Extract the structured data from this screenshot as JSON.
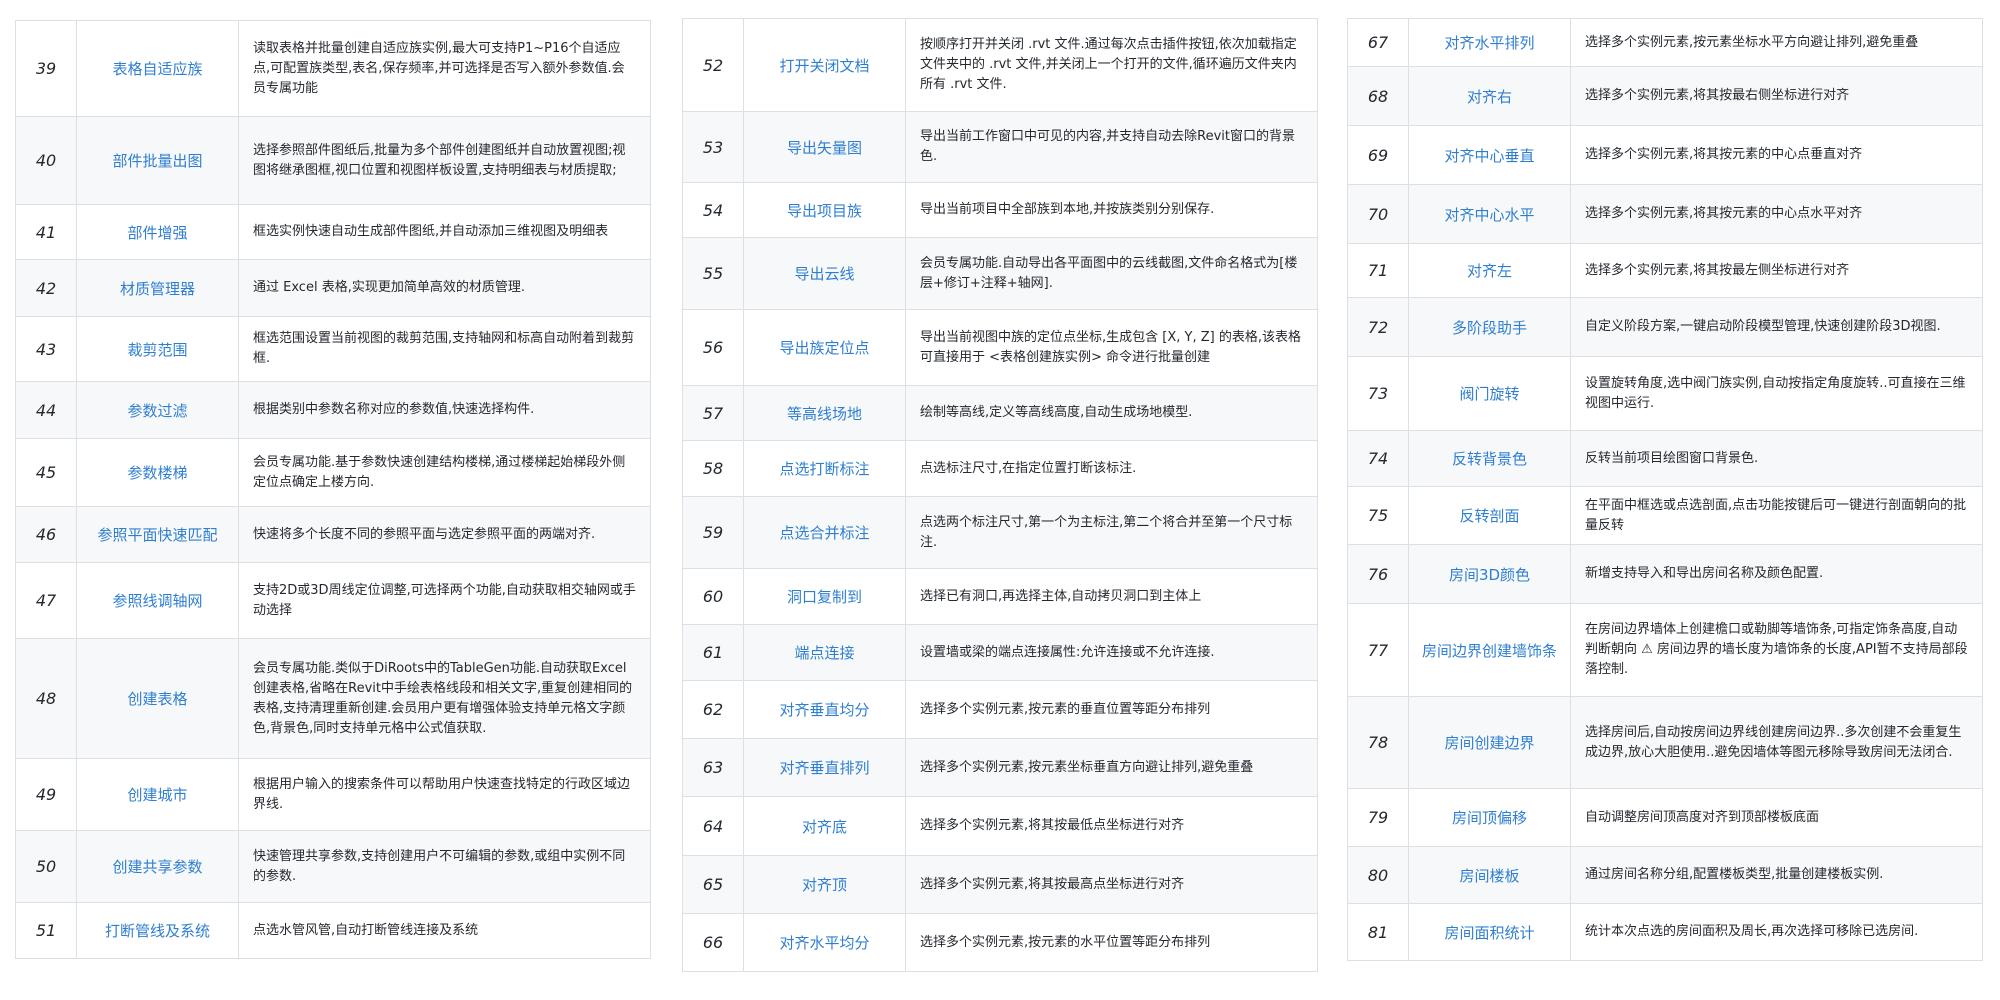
{
  "columns": [
    {
      "rows": [
        {
          "num": "39",
          "name": "表格自适应族",
          "desc": "读取表格并批量创建自适应族实例,最大可支持P1~P16个自适应点,可配置族类型,表名,保存频率,并可选择是否写入额外参数值.会员专属功能"
        },
        {
          "num": "40",
          "name": "部件批量出图",
          "desc": "选择参照部件图纸后,批量为多个部件创建图纸并自动放置视图;视图将继承图框,视口位置和视图样板设置,支持明细表与材质提取;"
        },
        {
          "num": "41",
          "name": "部件增强",
          "desc": "框选实例快速自动生成部件图纸,并自动添加三维视图及明细表"
        },
        {
          "num": "42",
          "name": "材质管理器",
          "desc": "通过 Excel 表格,实现更加简单高效的材质管理."
        },
        {
          "num": "43",
          "name": "裁剪范围",
          "desc": "框选范围设置当前视图的裁剪范围,支持轴网和标高自动附着到裁剪框."
        },
        {
          "num": "44",
          "name": "参数过滤",
          "desc": "根据类别中参数名称对应的参数值,快速选择构件."
        },
        {
          "num": "45",
          "name": "参数楼梯",
          "desc": "会员专属功能.基于参数快速创建结构楼梯,通过楼梯起始梯段外侧定位点确定上楼方向."
        },
        {
          "num": "46",
          "name": "参照平面快速匹配",
          "desc": "快速将多个长度不同的参照平面与选定参照平面的两端对齐."
        },
        {
          "num": "47",
          "name": "参照线调轴网",
          "desc": "支持2D或3D周线定位调整,可选择两个功能,自动获取相交轴网或手动选择"
        },
        {
          "num": "48",
          "name": "创建表格",
          "desc": "会员专属功能.类似于DiRoots中的TableGen功能.自动获取Excel创建表格,省略在Revit中手绘表格线段和相关文字,重复创建相同的表格,支持清理重新创建.会员用户更有增强体验支持单元格文字颜色,背景色,同时支持单元格中公式值获取."
        },
        {
          "num": "49",
          "name": "创建城市",
          "desc": "根据用户输入的搜索条件可以帮助用户快速查找特定的行政区域边界线."
        },
        {
          "num": "50",
          "name": "创建共享参数",
          "desc": "快速管理共享参数,支持创建用户不可编辑的参数,或组中实例不同的参数."
        },
        {
          "num": "51",
          "name": "打断管线及系统",
          "desc": "点选水管风管,自动打断管线连接及系统"
        }
      ]
    },
    {
      "rows": [
        {
          "num": "52",
          "name": "打开关闭文档",
          "desc": "按顺序打开并关闭 .rvt 文件.通过每次点击插件按钮,依次加载指定文件夹中的 .rvt 文件,并关闭上一个打开的文件,循环遍历文件夹内所有 .rvt 文件."
        },
        {
          "num": "53",
          "name": "导出矢量图",
          "desc": "导出当前工作窗口中可见的内容,并支持自动去除Revit窗口的背景色."
        },
        {
          "num": "54",
          "name": "导出项目族",
          "desc": "导出当前项目中全部族到本地,并按族类别分别保存."
        },
        {
          "num": "55",
          "name": "导出云线",
          "desc": "会员专属功能.自动导出各平面图中的云线截图,文件命名格式为[楼层+修订+注释+轴网]."
        },
        {
          "num": "56",
          "name": "导出族定位点",
          "desc": "导出当前视图中族的定位点坐标,生成包含 [X, Y, Z] 的表格,该表格可直接用于 <表格创建族实例> 命令进行批量创建"
        },
        {
          "num": "57",
          "name": "等高线场地",
          "desc": "绘制等高线,定义等高线高度,自动生成场地模型."
        },
        {
          "num": "58",
          "name": "点选打断标注",
          "desc": "点选标注尺寸,在指定位置打断该标注."
        },
        {
          "num": "59",
          "name": "点选合并标注",
          "desc": "点选两个标注尺寸,第一个为主标注,第二个将合并至第一个尺寸标注."
        },
        {
          "num": "60",
          "name": "洞口复制到",
          "desc": "选择已有洞口,再选择主体,自动拷贝洞口到主体上"
        },
        {
          "num": "61",
          "name": "端点连接",
          "desc": "设置墙或梁的端点连接属性:允许连接或不允许连接."
        },
        {
          "num": "62",
          "name": "对齐垂直均分",
          "desc": "选择多个实例元素,按元素的垂直位置等距分布排列"
        },
        {
          "num": "63",
          "name": "对齐垂直排列",
          "desc": "选择多个实例元素,按元素坐标垂直方向避让排列,避免重叠"
        },
        {
          "num": "64",
          "name": "对齐底",
          "desc": "选择多个实例元素,将其按最低点坐标进行对齐"
        },
        {
          "num": "65",
          "name": "对齐顶",
          "desc": "选择多个实例元素,将其按最高点坐标进行对齐"
        },
        {
          "num": "66",
          "name": "对齐水平均分",
          "desc": "选择多个实例元素,按元素的水平位置等距分布排列"
        }
      ]
    },
    {
      "rows": [
        {
          "num": "67",
          "name": "对齐水平排列",
          "desc": "选择多个实例元素,按元素坐标水平方向避让排列,避免重叠"
        },
        {
          "num": "68",
          "name": "对齐右",
          "desc": "选择多个实例元素,将其按最右侧坐标进行对齐"
        },
        {
          "num": "69",
          "name": "对齐中心垂直",
          "desc": "选择多个实例元素,将其按元素的中心点垂直对齐"
        },
        {
          "num": "70",
          "name": "对齐中心水平",
          "desc": "选择多个实例元素,将其按元素的中心点水平对齐"
        },
        {
          "num": "71",
          "name": "对齐左",
          "desc": "选择多个实例元素,将其按最左侧坐标进行对齐"
        },
        {
          "num": "72",
          "name": "多阶段助手",
          "desc": "自定义阶段方案,一键启动阶段模型管理,快速创建阶段3D视图."
        },
        {
          "num": "73",
          "name": "阀门旋转",
          "desc": "设置旋转角度,选中阀门族实例,自动按指定角度旋转..可直接在三维视图中运行."
        },
        {
          "num": "74",
          "name": "反转背景色",
          "desc": "反转当前项目绘图窗口背景色."
        },
        {
          "num": "75",
          "name": "反转剖面",
          "desc": "在平面中框选或点选剖面,点击功能按键后可一键进行剖面朝向的批量反转"
        },
        {
          "num": "76",
          "name": "房间3D颜色",
          "desc": "新增支持导入和导出房间名称及颜色配置."
        },
        {
          "num": "77",
          "name": "房间边界创建墙饰条",
          "desc": "在房间边界墙体上创建檐口或勒脚等墙饰条,可指定饰条高度,自动判断朝向 ⚠ 房间边界的墙长度为墙饰条的长度,API暂不支持局部段落控制."
        },
        {
          "num": "78",
          "name": "房间创建边界",
          "desc": "选择房间后,自动按房间边界线创建房间边界..多次创建不会重复生成边界,放心大胆使用..避免因墙体等图元移除导致房间无法闭合."
        },
        {
          "num": "79",
          "name": "房间顶偏移",
          "desc": "自动调整房间顶高度对齐到顶部楼板底面"
        },
        {
          "num": "80",
          "name": "房间楼板",
          "desc": "通过房间名称分组,配置楼板类型,批量创建楼板实例."
        },
        {
          "num": "81",
          "name": "房间面积统计",
          "desc": "统计本次点选的房间面积及周长,再次选择可移除已选房间."
        }
      ]
    }
  ]
}
